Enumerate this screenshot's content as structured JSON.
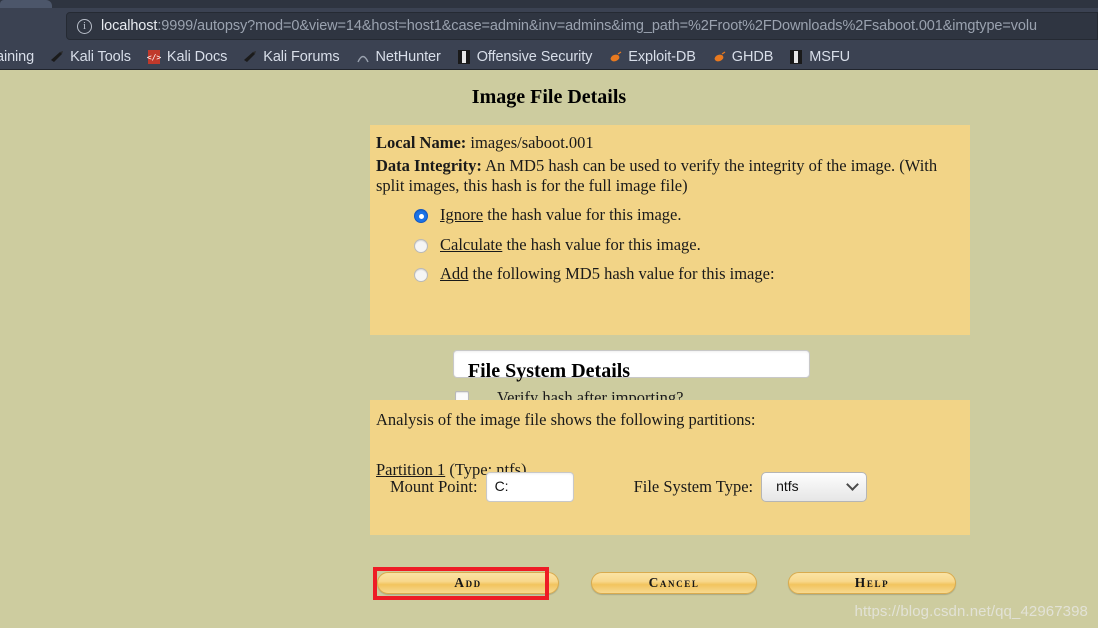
{
  "browser": {
    "url_host": "localhost",
    "url_rest": ":9999/autopsy?mod=0&view=14&host=host1&case=admin&inv=admins&img_path=%2Froot%2FDownloads%2Fsaboot.001&imgtype=volu",
    "info_icon": "info-icon",
    "bookmarks": [
      {
        "label": "aining",
        "icon": "training-icon"
      },
      {
        "label": "Kali Tools",
        "icon": "kali-dragon-icon"
      },
      {
        "label": "Kali Docs",
        "icon": "kali-docs-icon"
      },
      {
        "label": "Kali Forums",
        "icon": "kali-dragon-icon"
      },
      {
        "label": "NetHunter",
        "icon": "nethunter-icon"
      },
      {
        "label": "Offensive Security",
        "icon": "offsec-icon"
      },
      {
        "label": "Exploit-DB",
        "icon": "exploitdb-icon"
      },
      {
        "label": "GHDB",
        "icon": "ghdb-icon"
      },
      {
        "label": "MSFU",
        "icon": "msfu-icon"
      }
    ]
  },
  "page": {
    "image_file_details": {
      "title": "Image File Details",
      "local_name_label": "Local Name:",
      "local_name_value": "images/saboot.001",
      "data_integrity_label": "Data Integrity:",
      "data_integrity_text": "An MD5 hash can be used to verify the integrity of the image. (With split images, this hash is for the full image file)",
      "options": [
        {
          "keyword": "Ignore",
          "rest": " the hash value for this image.",
          "selected": true
        },
        {
          "keyword": "Calculate",
          "rest": " the hash value for this image.",
          "selected": false
        },
        {
          "keyword": "Add",
          "rest": " the following MD5 hash value for this image:",
          "selected": false
        }
      ],
      "hash_input_value": "",
      "hash_input_placeholder": "",
      "verify_checkbox_label": "Verify hash after importing?",
      "verify_checked": false
    },
    "file_system_details": {
      "title": "File System Details",
      "analysis_text": "Analysis of the image file shows the following partitions:",
      "partition_link": "Partition 1",
      "partition_type": " (Type: ntfs)",
      "mount_point_label": "Mount Point:",
      "mount_point_value": "C:",
      "fs_type_label": "File System Type:",
      "fs_type_value": "ntfs",
      "fs_type_options": [
        "ntfs"
      ]
    },
    "buttons": {
      "add": "Add",
      "cancel": "Cancel",
      "help": "Help"
    },
    "watermark": "https://blog.csdn.net/qq_42967398"
  },
  "colors": {
    "page_background": "#cdcc9f",
    "panel_background": "#f2d487",
    "chrome_background": "#3b4252",
    "highlight_red": "#ee1c25",
    "radio_selected_blue": "#1a73e8"
  }
}
